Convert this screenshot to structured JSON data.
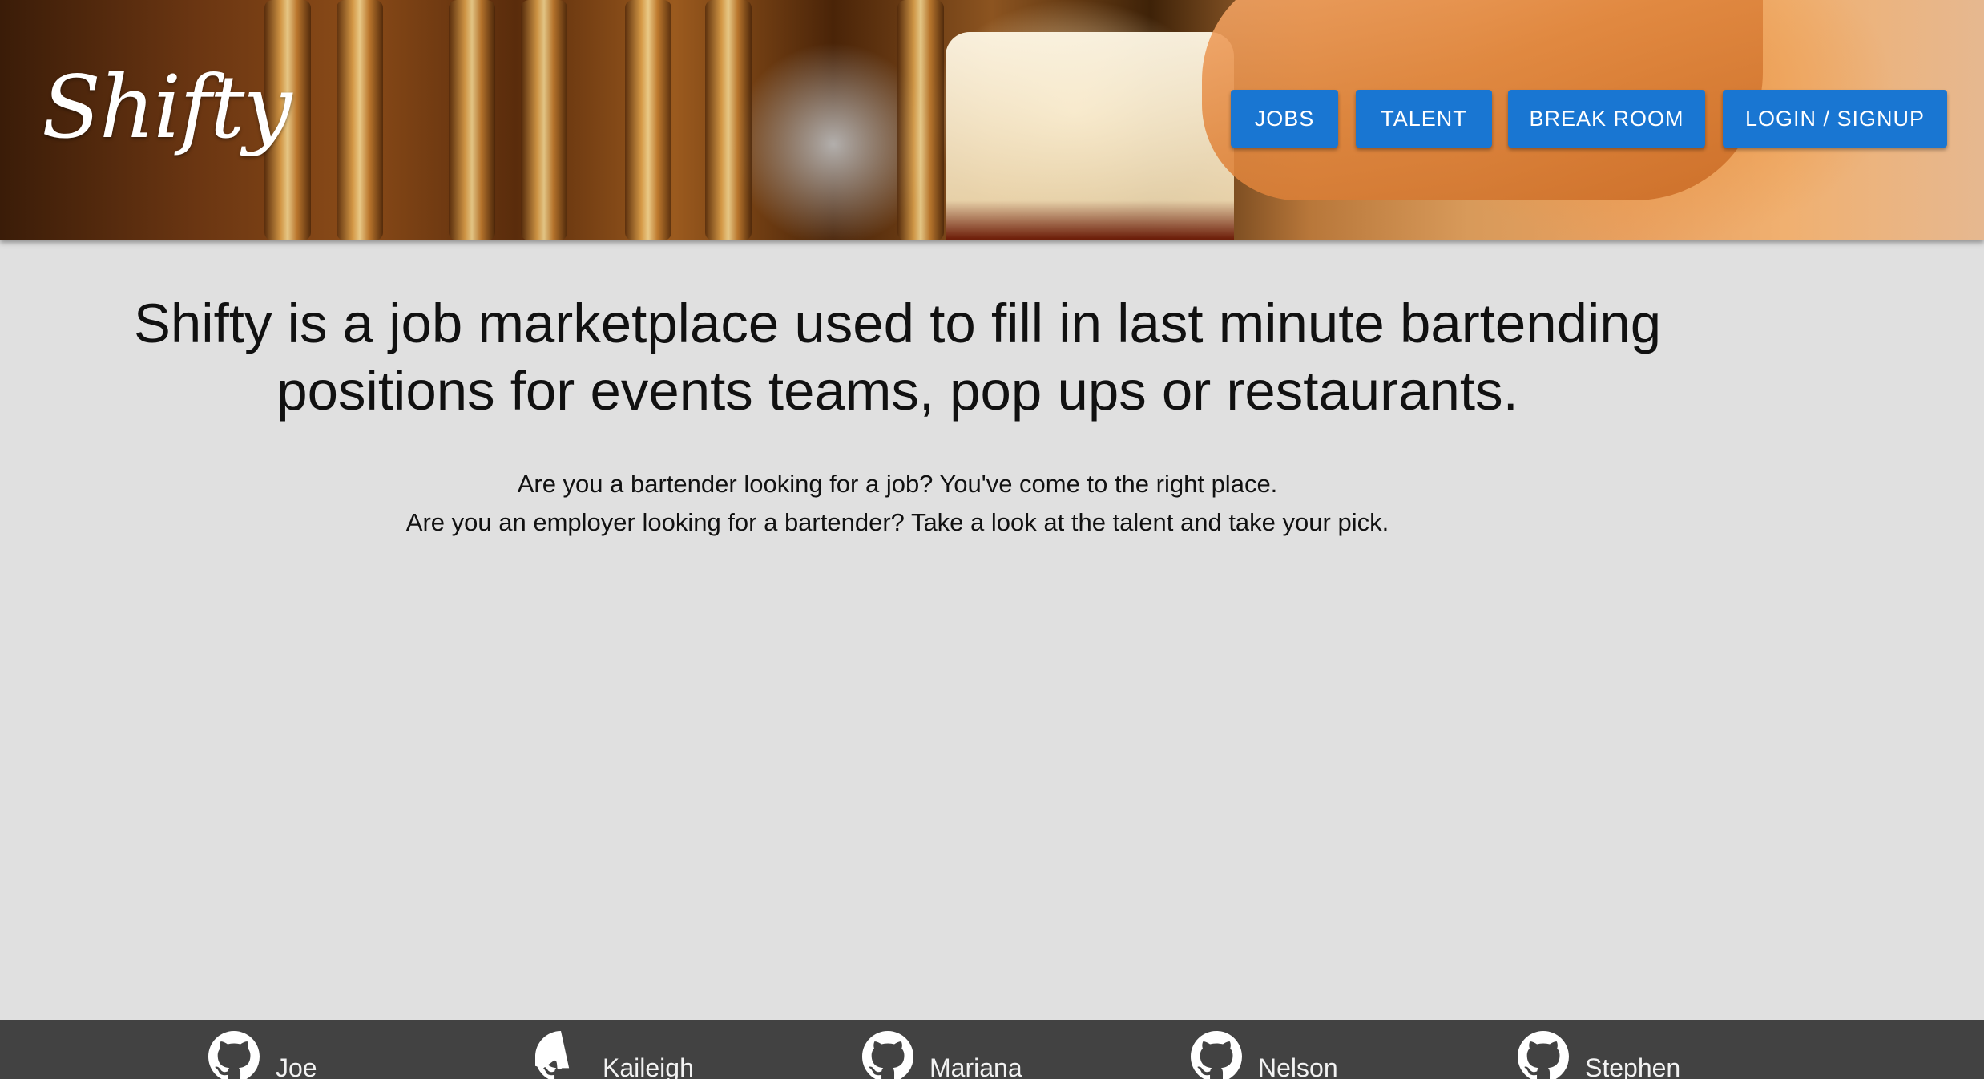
{
  "header": {
    "logo_text": "Shifty",
    "nav": [
      {
        "label": "JOBS"
      },
      {
        "label": "TALENT"
      },
      {
        "label": "BREAK ROOM"
      },
      {
        "label": "LOGIN / SIGNUP"
      }
    ],
    "accent_color": "#1976d2"
  },
  "main": {
    "headline": "Shifty is a job marketplace used to fill in last minute bartending positions for events teams, pop ups or restaurants.",
    "subtext": [
      "Are you a bartender looking for a job? You've come to the right place.",
      "Are you an employer looking for a bartender? Take a look at the talent and take your pick."
    ],
    "background_color": "#e0e0e0"
  },
  "footer": {
    "background_color": "#424242",
    "icon": "github-icon",
    "members": [
      {
        "name": "Joe"
      },
      {
        "name": "Kaileigh"
      },
      {
        "name": "Mariana"
      },
      {
        "name": "Nelson"
      },
      {
        "name": "Stephen"
      }
    ]
  }
}
